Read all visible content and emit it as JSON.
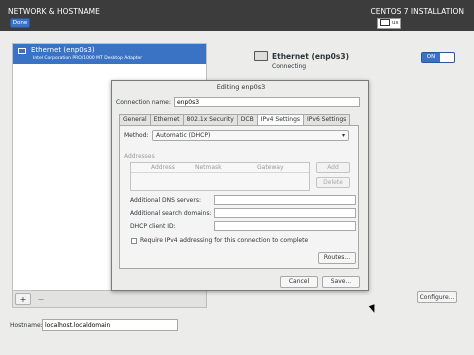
{
  "header": {
    "title": "NETWORK & HOSTNAME",
    "done_label": "Done",
    "install_title": "CENTOS 7 INSTALLATION",
    "keyboard_layout": "us",
    "background_color": "#3c3c3c",
    "accent_color": "#3b73c4"
  },
  "device_list": {
    "items": [
      {
        "name": "Ethernet (enp0s3)",
        "description": "Intel Corporation PRO/1000 MT Desktop Adapter",
        "selected": true
      }
    ],
    "add_label": "+",
    "remove_label": "−"
  },
  "device_detail": {
    "name": "Ethernet (enp0s3)",
    "status": "Connecting",
    "toggle_label": "ON",
    "configure_label": "Configure..."
  },
  "hostname": {
    "label": "Hostname:",
    "value": "localhost.localdomain"
  },
  "dialog": {
    "title": "Editing enp0s3",
    "connection_name_label": "Connection name:",
    "connection_name_value": "enp0s3",
    "tabs": [
      {
        "label": "General",
        "active": false
      },
      {
        "label": "Ethernet",
        "active": false
      },
      {
        "label": "802.1x Security",
        "active": false
      },
      {
        "label": "DCB",
        "active": false
      },
      {
        "label": "IPv4 Settings",
        "active": true
      },
      {
        "label": "IPv6 Settings",
        "active": false
      }
    ],
    "method_label": "Method:",
    "method_value": "Automatic (DHCP)",
    "addresses_label": "Addresses",
    "address_columns": [
      "Address",
      "Netmask",
      "Gateway"
    ],
    "add_label": "Add",
    "delete_label": "Delete",
    "dns_label": "Additional DNS servers:",
    "dns_value": "",
    "search_label": "Additional search domains:",
    "search_value": "",
    "dhcp_label": "DHCP client ID:",
    "dhcp_value": "",
    "require_ipv4_label": "Require IPv4 addressing for this connection to complete",
    "require_ipv4_checked": false,
    "routes_label": "Routes...",
    "cancel_label": "Cancel",
    "save_label": "Save..."
  }
}
